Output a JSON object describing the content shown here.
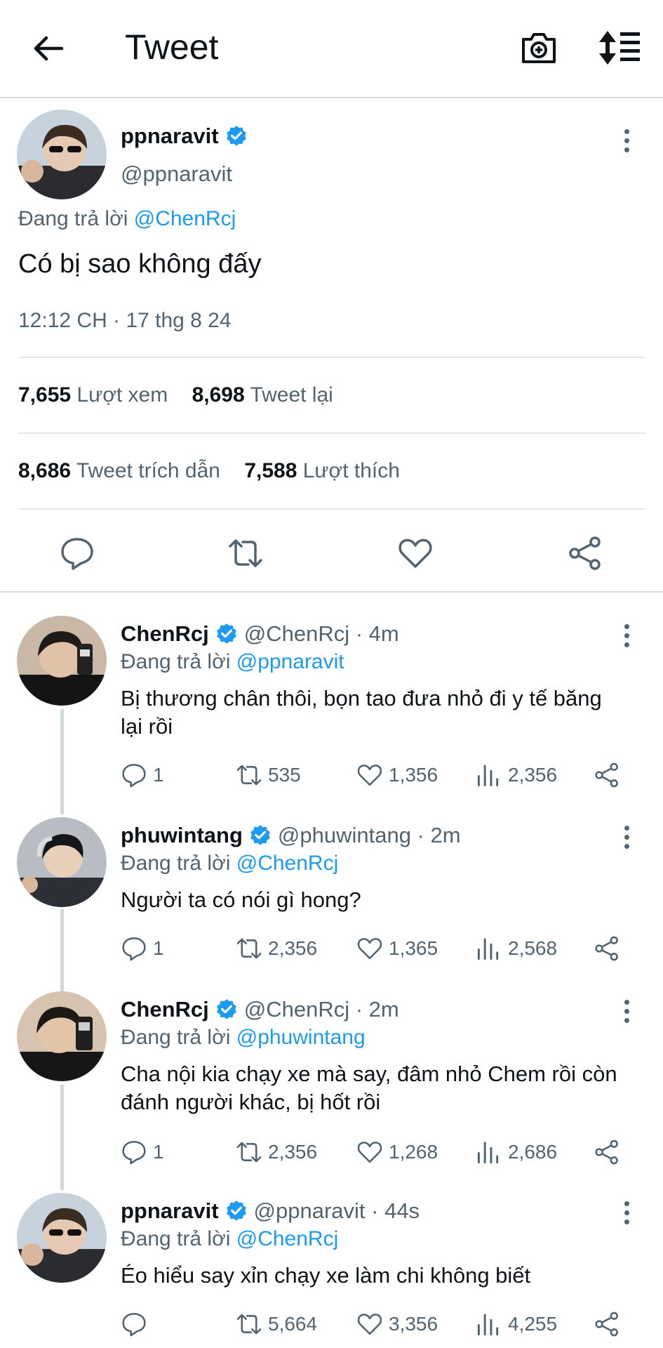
{
  "header": {
    "title": "Tweet"
  },
  "tweet": {
    "name": "ppnaravit",
    "handle": "@ppnaravit",
    "reply_prefix": "Đang trả lời",
    "reply_to": "@ChenRcj",
    "text": "Có bị sao không đấy",
    "time": "12:12 CH · 17 thg 8 24",
    "views": "7,655",
    "views_label": "Lượt xem",
    "retweets": "8,698",
    "retweets_label": "Tweet lại",
    "quotes": "8,686",
    "quotes_label": "Tweet trích dẫn",
    "likes": "7,588",
    "likes_label": "Lượt thích"
  },
  "replies": [
    {
      "name": "ChenRcj",
      "meta": "@ChenRcj · 4m",
      "reply_prefix": "Đang trả lời",
      "reply_to": "@ppnaravit",
      "text": "Bị thương chân thôi, bọn tao đưa nhỏ đi y tế băng lại rồi",
      "comments": "1",
      "retweets": "535",
      "likes": "1,356",
      "views": "2,356"
    },
    {
      "name": "phuwintang",
      "meta": "@phuwintang · 2m",
      "reply_prefix": "Đang trả lời",
      "reply_to": "@ChenRcj",
      "text": "Người ta có nói gì hong?",
      "comments": "1",
      "retweets": "2,356",
      "likes": "1,365",
      "views": "2,568"
    },
    {
      "name": "ChenRcj",
      "meta": "@ChenRcj · 2m",
      "reply_prefix": "Đang trả lời",
      "reply_to": "@phuwintang",
      "text": "Cha nội kia chạy xe mà say, đâm nhỏ Chem rồi còn đánh người khác, bị hốt rồi",
      "comments": "1",
      "retweets": "2,356",
      "likes": "1,268",
      "views": "2,686"
    },
    {
      "name": "ppnaravit",
      "meta": "@ppnaravit · 44s",
      "reply_prefix": "Đang trả lời",
      "reply_to": "@ChenRcj",
      "text": "Éo hiểu say xỉn chạy xe làm chi không biết",
      "comments": "",
      "retweets": "5,664",
      "likes": "3,356",
      "views": "4,255"
    }
  ],
  "colors": {
    "accent": "#1d9bf0",
    "text": "#0f1419",
    "muted": "#536471"
  }
}
